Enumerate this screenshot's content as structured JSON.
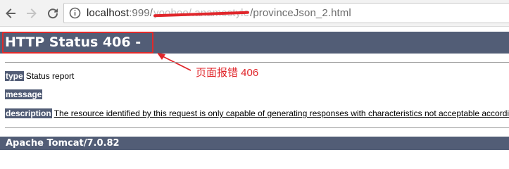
{
  "browser": {
    "url": {
      "host": "localhost",
      "port": ":999",
      "path_start": "/",
      "redacted_segment": "yoohoo/.anamestyle",
      "path_end": "/provinceJson_2.html"
    },
    "icons": {
      "back": "back-arrow-icon",
      "forward": "forward-arrow-icon",
      "reload": "reload-icon",
      "info": "info-icon"
    }
  },
  "error_page": {
    "title": "HTTP Status 406 -",
    "type_label": "type",
    "type_value": "Status report",
    "message_label": "message",
    "message_value": "",
    "description_label": "description",
    "description_value": "The resource identified by this request is only capable of generating responses with characteristics not acceptable according to the request \"accept\" headers.",
    "footer": "Apache Tomcat/7.0.82",
    "colors": {
      "bar": "#525d76",
      "annotation": "#e0262b"
    }
  },
  "annotation": {
    "text": "页面报错 406"
  }
}
